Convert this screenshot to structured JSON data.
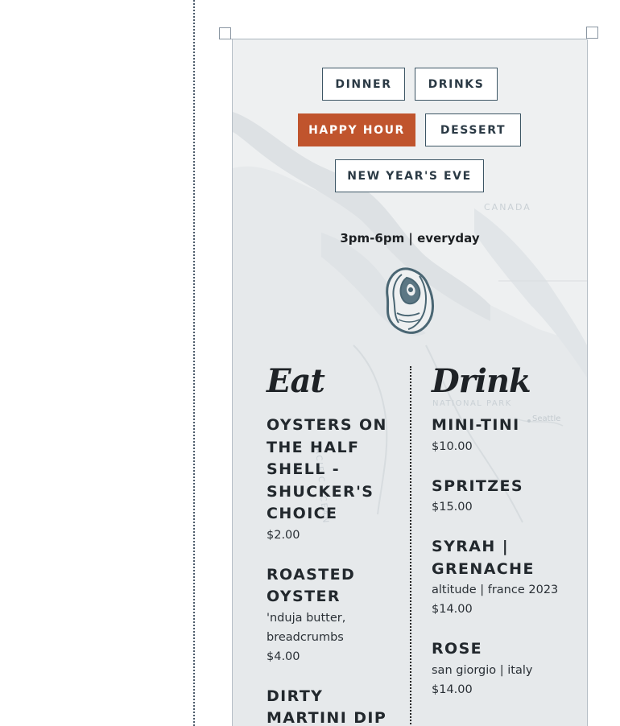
{
  "tabs": [
    {
      "label": "DINNER",
      "active": false
    },
    {
      "label": "DRINKS",
      "active": false
    },
    {
      "label": "HAPPY HOUR",
      "active": true
    },
    {
      "label": "DESSERT",
      "active": false
    },
    {
      "label": "NEW YEAR'S EVE",
      "active": false
    }
  ],
  "hours": "3pm-6pm | everyday",
  "map_labels": {
    "canada": "CANADA",
    "pacific": "PACIFIC OCEAN",
    "national_park": "NATIONAL PARK",
    "seattle": "Seattle"
  },
  "colors": {
    "accent": "#c0542d",
    "tab_border": "#3d5665",
    "panel_bg": "#eef0f1",
    "logo": "#4a6673"
  },
  "logo_icon": "oyster-logo-icon",
  "eat": {
    "heading": "Eat",
    "items": [
      {
        "name": "OYSTERS ON THE HALF SHELL - SHUCKER'S CHOICE",
        "desc": "",
        "price": "$2.00"
      },
      {
        "name": "ROASTED OYSTER",
        "desc": "'nduja butter, breadcrumbs",
        "price": "$4.00"
      },
      {
        "name": "DIRTY MARTINI DIP",
        "desc": "",
        "price": ""
      }
    ]
  },
  "drink": {
    "heading": "Drink",
    "items": [
      {
        "name": "MINI-TINI",
        "desc": "",
        "price": "$10.00"
      },
      {
        "name": "SPRITZES",
        "desc": "",
        "price": "$15.00"
      },
      {
        "name": "SYRAH | GRENACHE",
        "desc": "altitude | france 2023",
        "price": "$14.00"
      },
      {
        "name": "ROSE",
        "desc": "san giorgio | italy",
        "price": "$14.00"
      }
    ]
  }
}
